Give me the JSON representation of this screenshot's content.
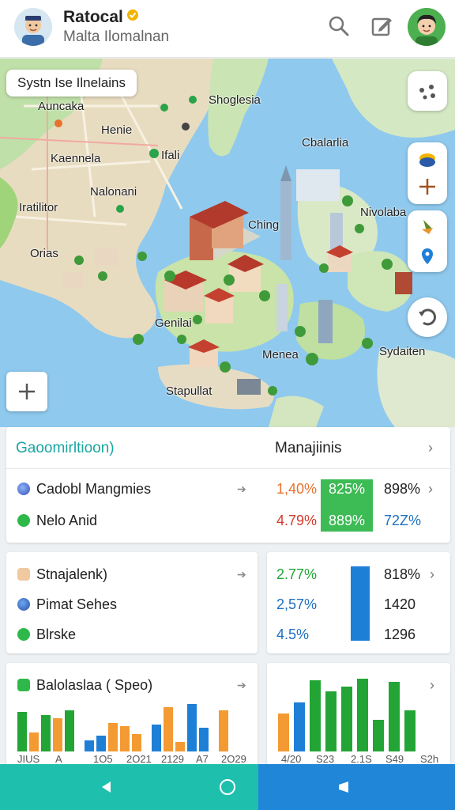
{
  "header": {
    "title": "Ratocal",
    "subtitle": "Malta Ilomalnan"
  },
  "map": {
    "search_text": "Systn Ise Ilnelains",
    "labels": [
      {
        "id": "shoglesia",
        "text": "Shoglesia"
      },
      {
        "id": "auncaka",
        "text": "Auncaka"
      },
      {
        "id": "henie",
        "text": "Henie"
      },
      {
        "id": "kaennela",
        "text": "Kaennela"
      },
      {
        "id": "ifali",
        "text": "Ifali"
      },
      {
        "id": "cbalarlia",
        "text": "Cbalarlia"
      },
      {
        "id": "iratilitor",
        "text": "Iratilitor"
      },
      {
        "id": "nalonani",
        "text": "Nalonani"
      },
      {
        "id": "nivolaba",
        "text": "Nivolaba"
      },
      {
        "id": "ching",
        "text": "Ching"
      },
      {
        "id": "orias",
        "text": "Orias"
      },
      {
        "id": "genilai",
        "text": "Genilai"
      },
      {
        "id": "menea",
        "text": "Menea"
      },
      {
        "id": "sydaiten",
        "text": "Sydaiten"
      },
      {
        "id": "stapullat",
        "text": "Stapullat"
      }
    ]
  },
  "card1": {
    "title": "Gaoomirltioon)",
    "title_right": "Manajiinis",
    "rows": [
      {
        "label": "Cadobl Mangmies",
        "v1": "1,40%",
        "v2": "825%",
        "v3": "898%"
      },
      {
        "label": "Nelo Anid",
        "v1": "4.79%",
        "v2": "889%",
        "v3": "72Z%"
      }
    ]
  },
  "card2": {
    "rows": [
      {
        "label": "Stnajalenk)"
      },
      {
        "label": "Pimat Sehes"
      },
      {
        "label": "Blrske"
      }
    ]
  },
  "card3": {
    "rows": [
      {
        "v1": "2.77%",
        "v2": "818%"
      },
      {
        "v1": "2,57%",
        "v2": "1420"
      },
      {
        "v1": "4.5%",
        "v2": "1296"
      }
    ]
  },
  "card4": {
    "title": "Balolaslaa ( Speo)",
    "axis": [
      "JIUS",
      "A",
      "1O5",
      "2O21",
      "2129",
      "A7",
      "2O29"
    ]
  },
  "card5": {
    "axis": [
      "4/20",
      "S23",
      "2.1S",
      "S49",
      "S2h"
    ]
  },
  "colors": {
    "green": "#22a535",
    "orange": "#f39a33",
    "blue": "#1e7fd6",
    "red_text": "#d43a2a",
    "teal_title": "#1aa6a0",
    "teal_nav": "#1fbfae",
    "blue_nav": "#1f86d8"
  },
  "charts": {
    "card4_bars": [
      {
        "h": 50,
        "c": "green"
      },
      {
        "h": 24,
        "c": "orange"
      },
      {
        "h": 46,
        "c": "green"
      },
      {
        "h": 42,
        "c": "orange"
      },
      {
        "h": 52,
        "c": "green"
      },
      {
        "h": 14,
        "c": "blue"
      },
      {
        "h": 20,
        "c": "blue"
      },
      {
        "h": 36,
        "c": "orange"
      },
      {
        "h": 32,
        "c": "orange"
      },
      {
        "h": 22,
        "c": "orange"
      },
      {
        "h": 34,
        "c": "blue"
      },
      {
        "h": 56,
        "c": "orange"
      },
      {
        "h": 12,
        "c": "orange"
      },
      {
        "h": 60,
        "c": "blue"
      },
      {
        "h": 30,
        "c": "blue"
      },
      {
        "h": 52,
        "c": "orange"
      }
    ],
    "card5_bars": [
      {
        "h": 48,
        "c": "orange"
      },
      {
        "h": 62,
        "c": "blue"
      },
      {
        "h": 90,
        "c": "green"
      },
      {
        "h": 76,
        "c": "green"
      },
      {
        "h": 82,
        "c": "green"
      },
      {
        "h": 92,
        "c": "green"
      },
      {
        "h": 40,
        "c": "green"
      },
      {
        "h": 88,
        "c": "green"
      },
      {
        "h": 52,
        "c": "green"
      }
    ]
  }
}
